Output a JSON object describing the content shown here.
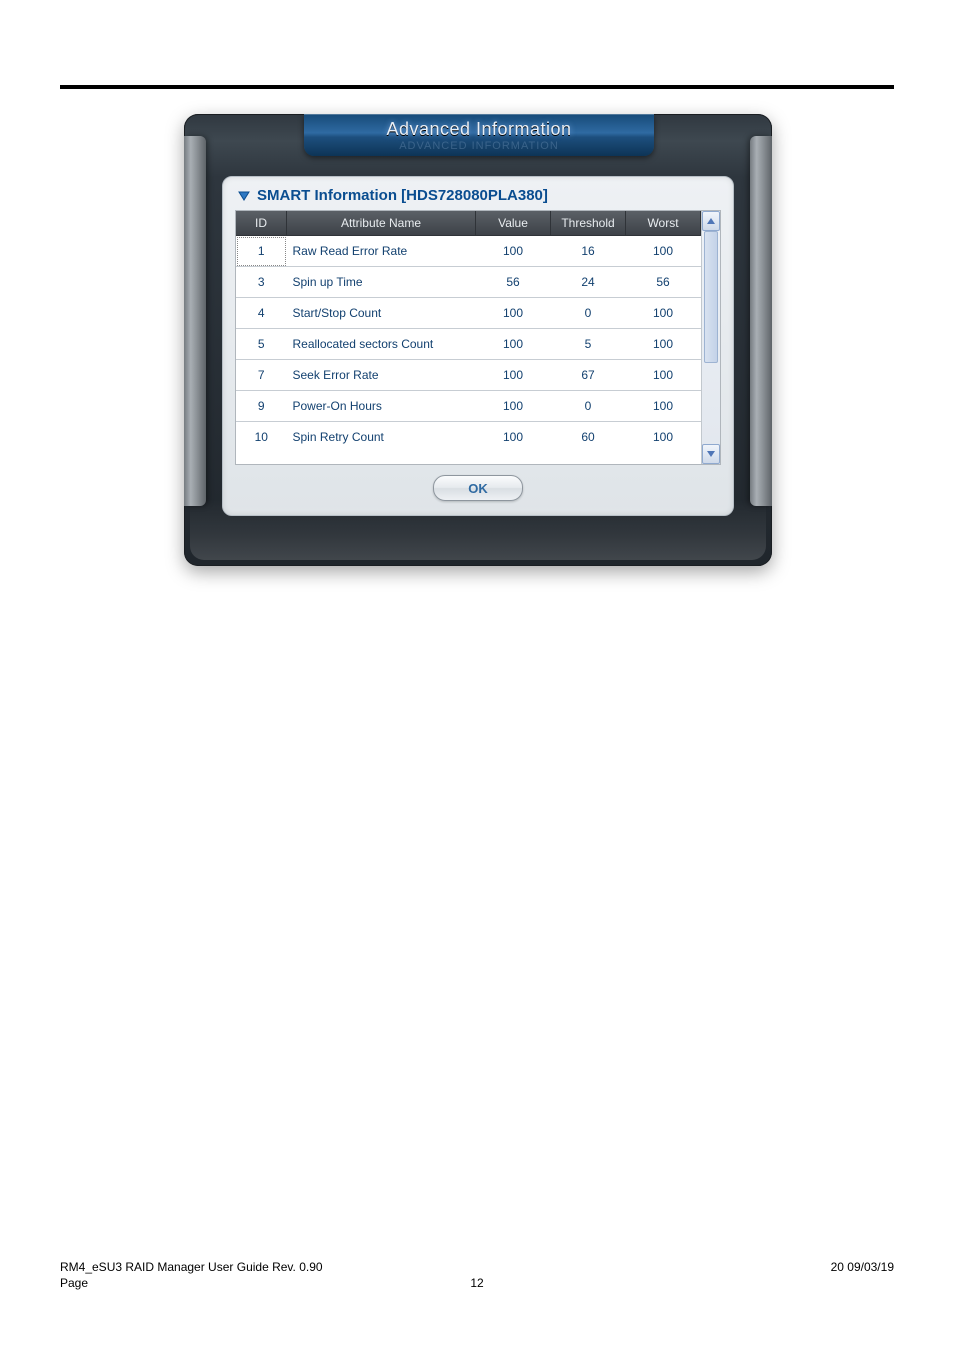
{
  "window": {
    "title": "Advanced Information",
    "title_shadow": "ADVANCED INFORMATION"
  },
  "section": {
    "title": "SMART Information [HDS728080PLA380]"
  },
  "table": {
    "headers": {
      "id": "ID",
      "attr": "Attribute Name",
      "value": "Value",
      "threshold": "Threshold",
      "worst": "Worst"
    },
    "rows": [
      {
        "id": "1",
        "attr": "Raw Read Error Rate",
        "value": "100",
        "threshold": "16",
        "worst": "100"
      },
      {
        "id": "3",
        "attr": "Spin up Time",
        "value": "56",
        "threshold": "24",
        "worst": "56"
      },
      {
        "id": "4",
        "attr": "Start/Stop Count",
        "value": "100",
        "threshold": "0",
        "worst": "100"
      },
      {
        "id": "5",
        "attr": "Reallocated sectors Count",
        "value": "100",
        "threshold": "5",
        "worst": "100"
      },
      {
        "id": "7",
        "attr": "Seek Error Rate",
        "value": "100",
        "threshold": "67",
        "worst": "100"
      },
      {
        "id": "9",
        "attr": "Power-On Hours",
        "value": "100",
        "threshold": "0",
        "worst": "100"
      },
      {
        "id": "10",
        "attr": "Spin Retry Count",
        "value": "100",
        "threshold": "60",
        "worst": "100"
      }
    ]
  },
  "buttons": {
    "ok": "OK"
  },
  "footer": {
    "doc": "RM4_eSU3  RAID Manager User Guide Rev. 0.90",
    "date_right": "20  09/03/19",
    "page_label": " Page",
    "page_num": "12"
  }
}
